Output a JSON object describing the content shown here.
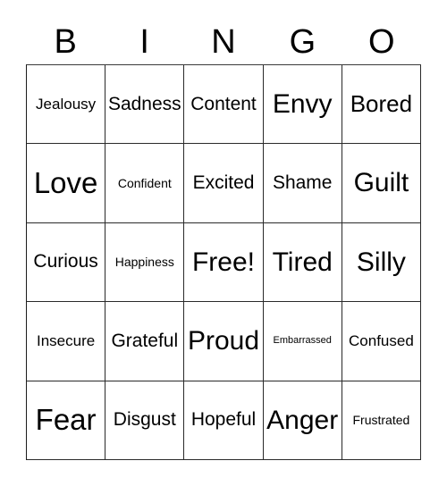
{
  "card": {
    "title_letters": [
      "B",
      "I",
      "N",
      "G",
      "O"
    ],
    "columns": 5,
    "rows": 5,
    "grid_line_color": "#2a2a2a",
    "background_color": "#ffffff",
    "text_color": "#000000",
    "rows_data": [
      [
        {
          "label": "Jealousy",
          "size": "sm"
        },
        {
          "label": "Sadness",
          "size": "md"
        },
        {
          "label": "Content",
          "size": "md"
        },
        {
          "label": "Envy",
          "size": "xl"
        },
        {
          "label": "Bored",
          "size": "lg"
        }
      ],
      [
        {
          "label": "Love",
          "size": "xxl"
        },
        {
          "label": "Confident",
          "size": "xs"
        },
        {
          "label": "Excited",
          "size": "md"
        },
        {
          "label": "Shame",
          "size": "md"
        },
        {
          "label": "Guilt",
          "size": "xl"
        }
      ],
      [
        {
          "label": "Curious",
          "size": "md"
        },
        {
          "label": "Happiness",
          "size": "xs"
        },
        {
          "label": "Free!",
          "size": "xl"
        },
        {
          "label": "Tired",
          "size": "xl"
        },
        {
          "label": "Silly",
          "size": "xl"
        }
      ],
      [
        {
          "label": "Insecure",
          "size": "sm"
        },
        {
          "label": "Grateful",
          "size": "md"
        },
        {
          "label": "Proud",
          "size": "xl"
        },
        {
          "label": "Embarrassed",
          "size": "xxs"
        },
        {
          "label": "Confused",
          "size": "sm"
        }
      ],
      [
        {
          "label": "Fear",
          "size": "xxl"
        },
        {
          "label": "Disgust",
          "size": "md"
        },
        {
          "label": "Hopeful",
          "size": "md"
        },
        {
          "label": "Anger",
          "size": "xl"
        },
        {
          "label": "Frustrated",
          "size": "xs"
        }
      ]
    ]
  }
}
